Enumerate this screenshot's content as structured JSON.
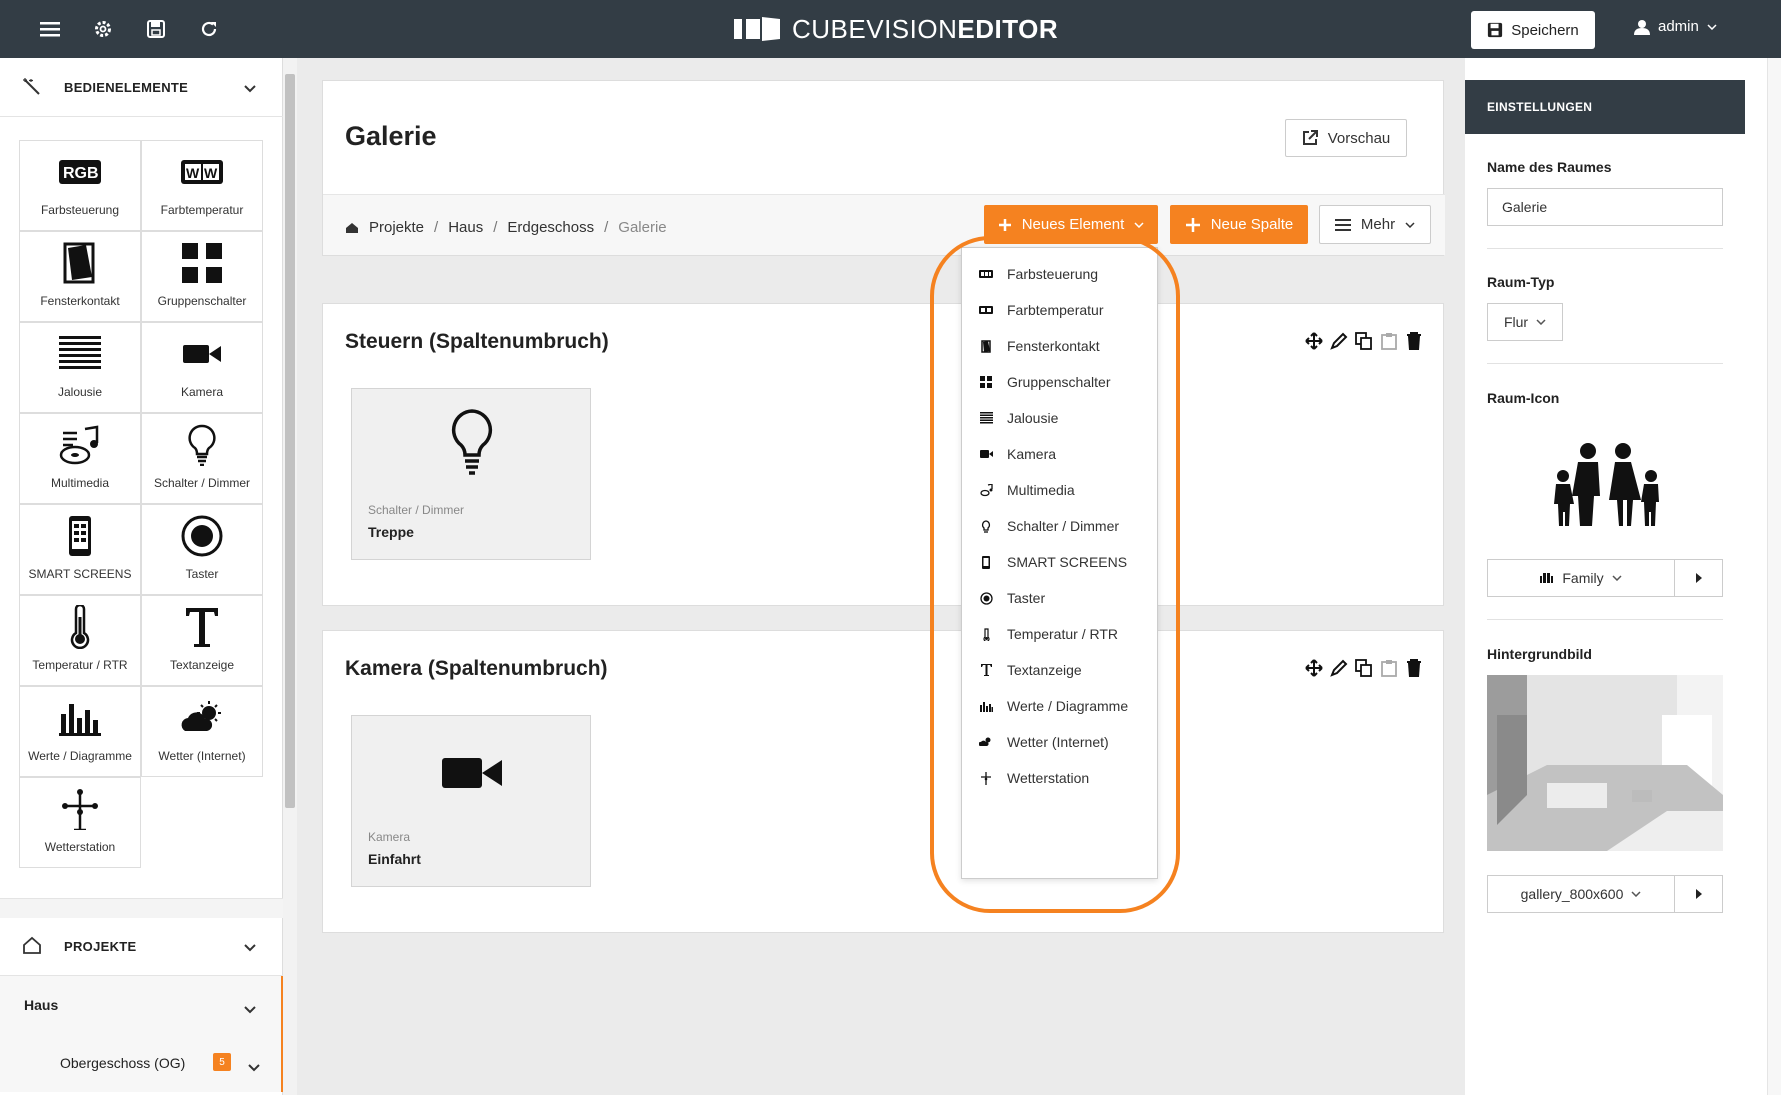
{
  "topbar": {
    "logo_light": "CUBEVISION",
    "logo_bold": "EDITOR",
    "save_label": "Speichern",
    "user": "admin"
  },
  "sidebar": {
    "controls_header": "BEDIENELEMENTE",
    "tiles": [
      {
        "label": "Farbsteuerung",
        "icon": "rgb-icon"
      },
      {
        "label": "Farbtemperatur",
        "icon": "ww-icon"
      },
      {
        "label": "Fensterkontakt",
        "icon": "window-icon"
      },
      {
        "label": "Gruppenschalter",
        "icon": "grid-icon"
      },
      {
        "label": "Jalousie",
        "icon": "blind-icon"
      },
      {
        "label": "Kamera",
        "icon": "camera-icon"
      },
      {
        "label": "Multimedia",
        "icon": "music-icon"
      },
      {
        "label": "Schalter / Dimmer",
        "icon": "bulb-icon"
      },
      {
        "label": "SMART SCREENS",
        "icon": "phone-icon"
      },
      {
        "label": "Taster",
        "icon": "button-icon"
      },
      {
        "label": "Temperatur / RTR",
        "icon": "thermometer-icon"
      },
      {
        "label": "Textanzeige",
        "icon": "text-icon"
      },
      {
        "label": "Werte / Diagramme",
        "icon": "bar-chart-icon"
      },
      {
        "label": "Wetter (Internet)",
        "icon": "weather-icon"
      },
      {
        "label": "Wetterstation",
        "icon": "weather-station-icon"
      }
    ],
    "projects_header": "PROJEKTE",
    "tree": {
      "house": "Haus",
      "floor": "Obergeschoss (OG)",
      "floor_badge": "5"
    }
  },
  "main": {
    "title": "Galerie",
    "preview_label": "Vorschau",
    "breadcrumb": [
      "Projekte",
      "Haus",
      "Erdgeschoss",
      "Galerie"
    ],
    "new_element_label": "Neues Element",
    "new_column_label": "Neue Spalte",
    "more_label": "Mehr",
    "sections": [
      {
        "title": "Steuern (Spaltenumbruch)",
        "element_type": "Schalter / Dimmer",
        "element_name": "Treppe"
      },
      {
        "title": "Kamera (Spaltenumbruch)",
        "element_type": "Kamera",
        "element_name": "Einfahrt"
      }
    ],
    "dropdown": [
      "Farbsteuerung",
      "Farbtemperatur",
      "Fensterkontakt",
      "Gruppenschalter",
      "Jalousie",
      "Kamera",
      "Multimedia",
      "Schalter / Dimmer",
      "SMART SCREENS",
      "Taster",
      "Temperatur / RTR",
      "Textanzeige",
      "Werte / Diagramme",
      "Wetter (Internet)",
      "Wetterstation"
    ]
  },
  "settings": {
    "header": "EINSTELLUNGEN",
    "room_name_label": "Name des Raumes",
    "room_name_value": "Galerie",
    "room_type_label": "Raum-Typ",
    "room_type_value": "Flur",
    "room_icon_label": "Raum-Icon",
    "room_icon_value": "Family",
    "background_label": "Hintergrundbild",
    "background_value": "gallery_800x600"
  },
  "colors": {
    "accent": "#f58220",
    "topbar": "#333d45"
  }
}
